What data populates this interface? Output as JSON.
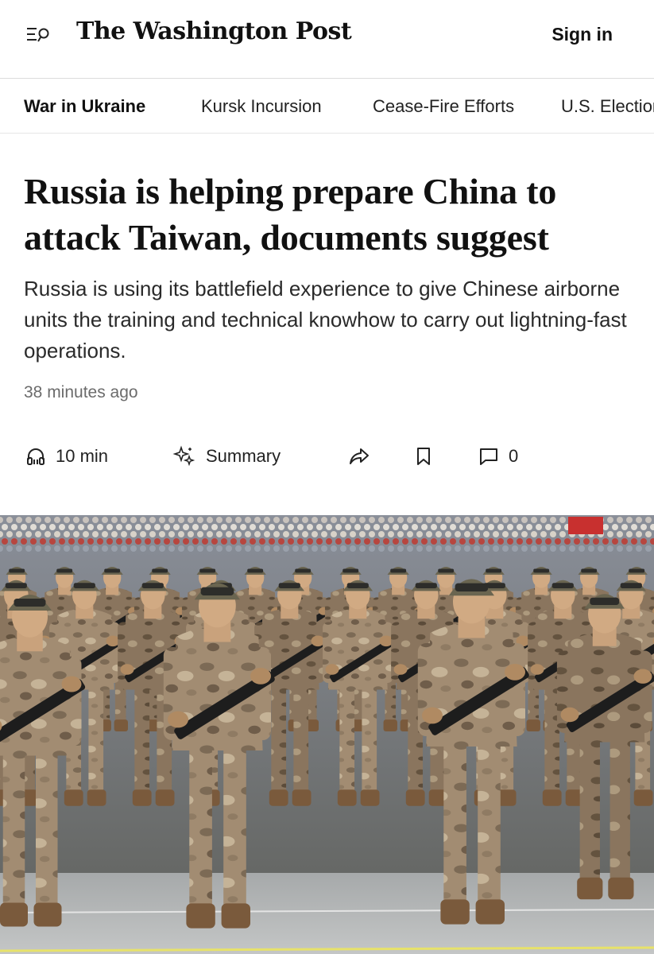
{
  "header": {
    "menu_icon": "menu-search-icon",
    "masthead": "The Washington Post",
    "sign_in_label": "Sign in"
  },
  "subnav": {
    "items": [
      {
        "label": "War in Ukraine",
        "active": true
      },
      {
        "label": "Kursk Incursion",
        "active": false
      },
      {
        "label": "Cease-Fire Efforts",
        "active": false
      },
      {
        "label": "U.S. Election",
        "active": false
      }
    ]
  },
  "article": {
    "headline": "Russia is helping prepare China to attack Taiwan, documents suggest",
    "dek": "Russia is using its battlefield experience to give Chinese airborne units the training and technical knowhow to carry out lightning-fast operations.",
    "timestamp": "38 minutes ago"
  },
  "tools": {
    "listen_icon": "headphones-icon",
    "listen_label": "10 min",
    "summary_icon": "sparkle-icon",
    "summary_label": "Summary",
    "share_icon": "share-icon",
    "save_icon": "bookmark-icon",
    "comments_icon": "comment-icon",
    "comments_count": "0"
  },
  "photo": {
    "subject": "Rows of soldiers in camouflage uniforms and helmets marching with rifles in a parade, crowd in the background"
  },
  "colors": {
    "text": "#111111",
    "muted": "#6b6b6b",
    "divider": "#dcdcdc"
  }
}
